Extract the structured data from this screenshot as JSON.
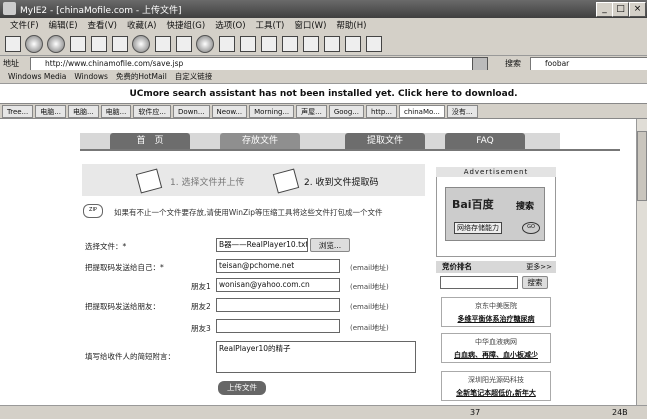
{
  "window": {
    "title": "MyIE2 - [chinaMofile.com - 上传文件]",
    "minimize": "_",
    "maximize": "□",
    "close": "×"
  },
  "menu": [
    "文件(F)",
    "编辑(E)",
    "查看(V)",
    "收藏(A)",
    "快捷组(G)",
    "选项(O)",
    "工具(T)",
    "窗口(W)",
    "帮助(H)"
  ],
  "address": {
    "label": "地址",
    "url": "http://www.chinamofile.com/save.jsp",
    "search_label": "搜索",
    "search_value": "foobar"
  },
  "links": [
    "Windows Media",
    "Windows",
    "免费的HotMail",
    "自定义链接"
  ],
  "notice": "UCmore search assistant has not been installed yet. Click here to download.",
  "tabs": [
    "Tree...",
    "电脑...",
    "电脑...",
    "电脑...",
    "软件应...",
    "Down...",
    "Neow...",
    "Morning...",
    "声屋...",
    "Goog...",
    "http...",
    "chinaMo...",
    "没有..."
  ],
  "nav": [
    "首　页",
    "存放文件",
    "提取文件",
    "FAQ"
  ],
  "steps": {
    "step1": "1. 选择文件并上传",
    "step2": "2. 收到文件提取码"
  },
  "tip": "如果有不止一个文件要存放,请使用WinZip等压缩工具将这些文件打包成一个文件",
  "zip_label": "ZIP",
  "form": {
    "select_label": "选择文件：*",
    "file_value": "B器——RealPlayer10.txt",
    "browse_button": "浏览...",
    "self_label": "把提取码发送给自己：*",
    "self_email": "teisan@pchome.net",
    "email_note": "(email地址)",
    "friends_label": "把提取码发送给朋友：",
    "friend1_label": "朋友1",
    "friend1_email": "wonisan@yahoo.com.cn",
    "friend2_label": "朋友2",
    "friend2_email": "",
    "friend3_label": "朋友3",
    "friend3_email": "",
    "message_label": "填写给收件人的简短附言：",
    "message_value": "RealPlayer10的精子",
    "upload_button": "上传文件"
  },
  "sidebar": {
    "ad_header": "Advertisement",
    "baidu_logo": "Bai百度",
    "baidu_search": "搜索",
    "baidu_slogan": "网络存储能力",
    "baidu_go": "GO",
    "rank_title": "竞价排名",
    "rank_more": "更多>>",
    "rank_search_button": "搜索",
    "ads": [
      {
        "name": "京东中美医院",
        "text": "多维平衡体系治疗糖尿病"
      },
      {
        "name": "中华血液病网",
        "text": "白血病、再障、血小板减少"
      },
      {
        "name": "深圳阳光源码科技",
        "text": "全新笔记本超低价,新年大"
      }
    ]
  },
  "status": {
    "count": "37",
    "speed": "24B"
  }
}
